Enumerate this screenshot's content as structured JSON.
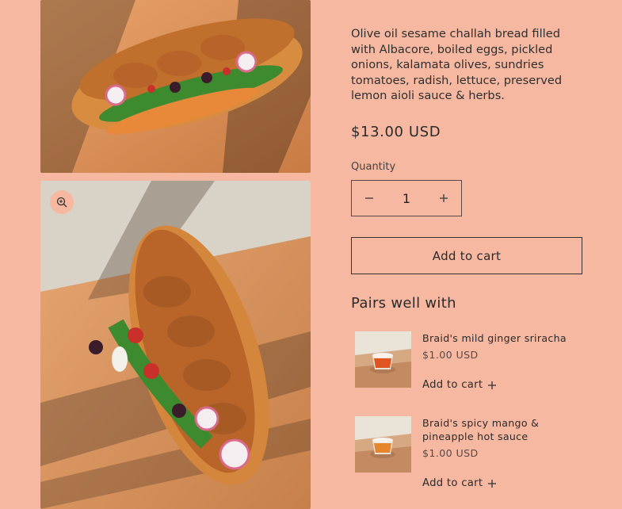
{
  "product": {
    "description": "Olive oil sesame challah bread filled with Albacore, boiled eggs, pickled onions, kalamata olives, sundries tomatoes, radish, lettuce, preserved lemon aioli sauce & herbs.",
    "price": "$13.00 USD",
    "quantity_label": "Quantity",
    "quantity_value": "1",
    "add_to_cart_label": "Add to cart"
  },
  "gallery": {
    "zoom_icon": "zoom-in-icon"
  },
  "pairs": {
    "heading": "Pairs well with",
    "items": [
      {
        "name": "Braid's mild ginger sriracha",
        "price": "$1.00 USD",
        "add_label": "Add to cart",
        "sauce_color": "#e0541f"
      },
      {
        "name": "Braid's spicy mango & pineapple hot sauce",
        "price": "$1.00 USD",
        "add_label": "Add to cart",
        "sauce_color": "#e6862c"
      }
    ]
  },
  "colors": {
    "background": "#f6b8a0",
    "text": "#2b2b2b"
  }
}
